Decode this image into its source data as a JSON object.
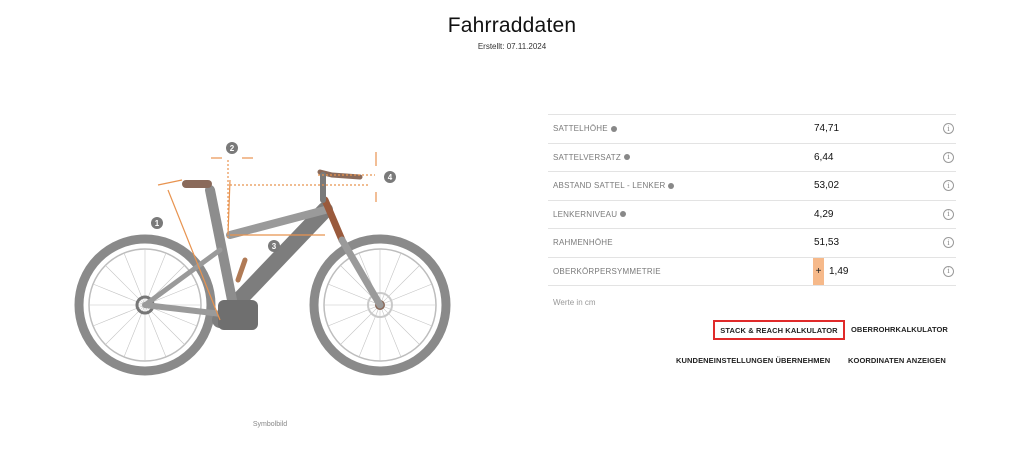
{
  "header": {
    "title": "Fahrraddaten",
    "created": "Erstellt: 07.11.2024"
  },
  "bike": {
    "caption": "Symbolbild",
    "markers": [
      "1",
      "2",
      "3",
      "4"
    ],
    "accent_color": "#e8934f"
  },
  "table": {
    "rows": [
      {
        "label": "SATTELHÖHE",
        "value": "74,71"
      },
      {
        "label": "SATTELVERSATZ",
        "value": "6,44"
      },
      {
        "label": "ABSTAND SATTEL - LENKER",
        "value": "53,02"
      },
      {
        "label": "LENKERNIVEAU",
        "value": "4,29"
      },
      {
        "label": "RAHMENHÖHE",
        "value": "51,53"
      },
      {
        "label": "OBERKÖRPERSYMMETRIE",
        "value": "1,49",
        "badge": "+"
      }
    ],
    "info_symbol": "i",
    "note": "Werte in cm"
  },
  "actions": {
    "stack_reach": "STACK & REACH KALKULATOR",
    "oberrohr": "OBERROHRKALKULATOR",
    "kunden": "KUNDENEINSTELLUNGEN ÜBERNEHMEN",
    "koordinaten": "KOORDINATEN ANZEIGEN"
  },
  "colors": {
    "highlight_border": "#e02a2a",
    "badge_bg": "#f6b98a"
  }
}
